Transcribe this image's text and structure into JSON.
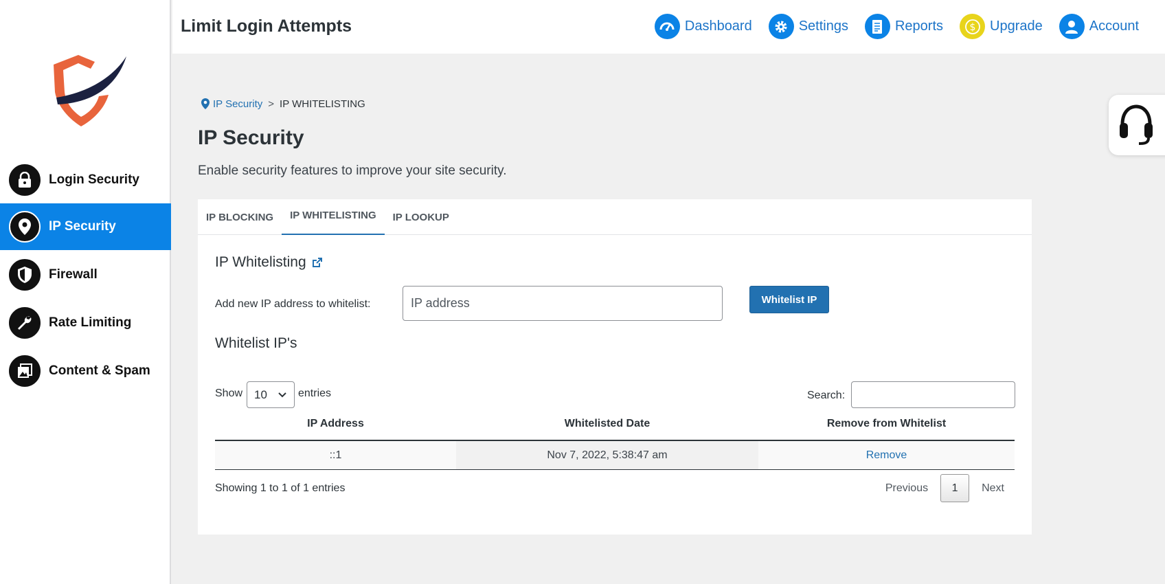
{
  "app": {
    "title": "Limit Login Attempts"
  },
  "colors": {
    "accent": "#0b83e6",
    "link": "#2271b1",
    "upgrade": "#e8d41b",
    "logo_orange": "#e8643c",
    "logo_navy": "#1b2140"
  },
  "nav": {
    "items": [
      {
        "label": "Dashboard",
        "icon": "dashboard-icon"
      },
      {
        "label": "Settings",
        "icon": "gear-icon"
      },
      {
        "label": "Reports",
        "icon": "report-icon"
      },
      {
        "label": "Upgrade",
        "icon": "dollar-icon"
      },
      {
        "label": "Account",
        "icon": "user-icon"
      }
    ]
  },
  "sidebar": {
    "items": [
      {
        "label": "Login Security",
        "icon": "lock-icon",
        "active": false
      },
      {
        "label": "IP Security",
        "icon": "location-pin-icon",
        "active": true
      },
      {
        "label": "Firewall",
        "icon": "shield-icon",
        "active": false
      },
      {
        "label": "Rate Limiting",
        "icon": "wrench-icon",
        "active": false
      },
      {
        "label": "Content & Spam",
        "icon": "image-gallery-icon",
        "active": false
      }
    ]
  },
  "breadcrumb": {
    "parent": "IP Security",
    "separator": ">",
    "current": "IP WHITELISTING"
  },
  "page": {
    "title": "IP Security",
    "subtitle": "Enable security features to improve your site security."
  },
  "tabs": [
    {
      "label": "IP BLOCKING",
      "active": false
    },
    {
      "label": "IP WHITELISTING",
      "active": true
    },
    {
      "label": "IP LOOKUP",
      "active": false
    }
  ],
  "whitelist": {
    "section_title": "IP Whitelisting",
    "add_label": "Add new IP address to whitelist:",
    "input_placeholder": "IP address",
    "input_value": "",
    "button_label": "Whitelist IP",
    "list_title": "Whitelist IP's"
  },
  "table": {
    "show_label": "Show",
    "page_length": "10",
    "entries_label": "entries",
    "search_label": "Search:",
    "search_value": "",
    "columns": [
      "IP Address",
      "Whitelisted Date",
      "Remove from Whitelist"
    ],
    "rows": [
      {
        "ip": "::1",
        "date": "Nov 7, 2022, 5:38:47 am",
        "action": "Remove"
      }
    ],
    "info": "Showing 1 to 1 of 1 entries",
    "pagination": {
      "previous": "Previous",
      "current_page": "1",
      "next": "Next"
    }
  }
}
